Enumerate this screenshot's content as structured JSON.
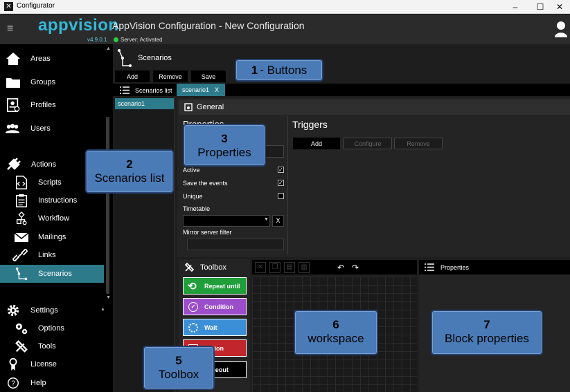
{
  "window": {
    "title": "Configurator",
    "controls": [
      "–",
      "☐",
      "✕"
    ]
  },
  "header": {
    "logo": "appvision",
    "version": "v4.9.0.1",
    "server_status": "Server: Activated",
    "title": "AppVision Configuration - New Configuration"
  },
  "sidebar": {
    "items": [
      {
        "label": "Areas",
        "icon": "house-icon"
      },
      {
        "label": "Groups",
        "icon": "folder-icon"
      },
      {
        "label": "Profiles",
        "icon": "profile-badge-icon"
      },
      {
        "label": "Users",
        "icon": "users-icon"
      },
      {
        "label": "Actions",
        "icon": "plug-icon"
      },
      {
        "label": "Scripts",
        "icon": "code-file-icon"
      },
      {
        "label": "Instructions",
        "icon": "clipboard-icon"
      },
      {
        "label": "Workflow",
        "icon": "workflow-icon"
      },
      {
        "label": "Mailings",
        "icon": "envelope-icon"
      },
      {
        "label": "Links",
        "icon": "link-icon"
      },
      {
        "label": "Scenarios",
        "icon": "scenario-icon",
        "active": true
      },
      {
        "label": "Settings",
        "icon": "gear-icon"
      },
      {
        "label": "Options",
        "icon": "gears-icon"
      },
      {
        "label": "Tools",
        "icon": "tools-icon"
      },
      {
        "label": "License",
        "icon": "license-icon"
      },
      {
        "label": "Help",
        "icon": "help-icon"
      }
    ]
  },
  "page": {
    "title": "Scenarios",
    "buttons": {
      "add": "Add",
      "remove": "Remove",
      "save": "Save"
    },
    "scenarios_list_label": "Scenarios list",
    "scenarios": [
      "scenario1"
    ],
    "open_tab": "scenario1",
    "open_tab_close": "X"
  },
  "general": {
    "title": "General",
    "properties_heading": "Properties",
    "active_label": "Active",
    "save_events_label": "Save the events",
    "unique_label": "Unique",
    "timetable_label": "Timetable",
    "timetable_clear": "X",
    "mirror_filter_label": "Mirror server filter",
    "checkmark": "✓"
  },
  "triggers": {
    "title": "Triggers",
    "add": "Add",
    "configure": "Configure",
    "remove": "Remove"
  },
  "toolbox": {
    "title": "Toolbox",
    "blocks": [
      {
        "label": "Repeat until",
        "color": "#1f9e3a"
      },
      {
        "label": "Condition",
        "color": "#9b4dcc"
      },
      {
        "label": "Wait",
        "color": "#3b8fd6"
      },
      {
        "label": "Action",
        "color": "#c0262b"
      },
      {
        "label": "Timeout",
        "color": "#000000"
      }
    ]
  },
  "block_properties": {
    "title": "Properties"
  },
  "callouts": [
    {
      "num": "1",
      "text": "- Buttons"
    },
    {
      "num": "2",
      "text": "Scenarios list"
    },
    {
      "num": "3",
      "text": "Properties"
    },
    {
      "num": "5",
      "text": "Toolbox"
    },
    {
      "num": "6",
      "text": "workspace"
    },
    {
      "num": "7",
      "text": "Block properties"
    }
  ],
  "colors": {
    "accent": "#2d7b8a",
    "logo": "#35b8d8",
    "callout": "#4a7bb7"
  }
}
